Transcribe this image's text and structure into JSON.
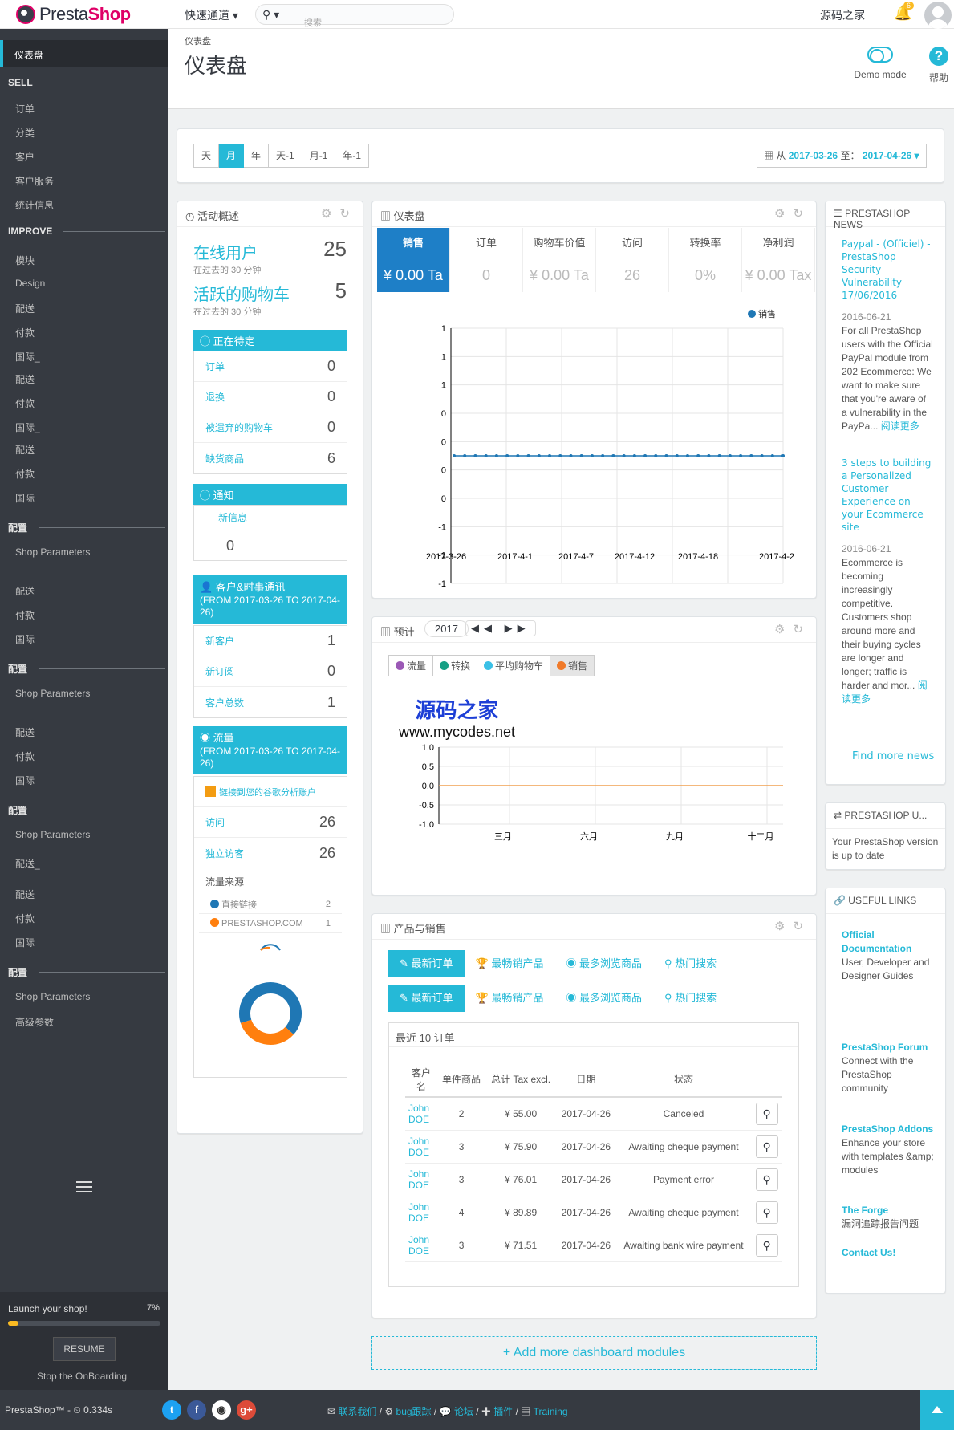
{
  "brand": {
    "name_part1": "Presta",
    "name_part2": "Shop"
  },
  "topbar": {
    "quick_access": "快速通道 ▾",
    "search_placeholder": "搜索",
    "shop_name": "源码之家",
    "notification_count": "6"
  },
  "sidebar": {
    "active": "仪表盘",
    "sections": [
      {
        "title": "SELL",
        "items": [
          "订单",
          "分类",
          "客户",
          "客户服务",
          "统计信息"
        ]
      },
      {
        "title": "IMPROVE",
        "items": [
          "模块",
          "Design",
          "配送",
          "付款",
          "国际_",
          "配送",
          "付款",
          "国际_",
          "配送",
          "付款",
          "国际"
        ]
      },
      {
        "title": "配置",
        "items": [
          "Shop Parameters",
          "配送",
          "付款",
          "国际"
        ]
      },
      {
        "title": "配置",
        "items": [
          "Shop Parameters",
          "配送",
          "付款",
          "国际"
        ]
      },
      {
        "title": "配置",
        "items": [
          "Shop Parameters",
          "配送_",
          "配送",
          "付款",
          "国际"
        ]
      },
      {
        "title": "配置",
        "items": [
          "Shop Parameters",
          "高级参数"
        ]
      }
    ],
    "launch": {
      "label": "Launch your shop!",
      "percent_text": "7%",
      "progress": 0.07,
      "resume": "RESUME",
      "stop": "Stop the OnBoarding"
    }
  },
  "header": {
    "breadcrumb": "仪表盘",
    "title": "仪表盘",
    "demo_mode": "Demo mode",
    "help": "帮助"
  },
  "datebar": {
    "periods": [
      "天",
      "月",
      "年",
      "天-1",
      "月-1",
      "年-1"
    ],
    "active_period": "月",
    "range_prefix": "从",
    "range_from": "2017-03-26",
    "range_sep": "至：",
    "range_to": "2017-04-26 ▾"
  },
  "activity": {
    "title": "活动概述",
    "online_label": "在线用户",
    "online_value": "25",
    "online_sub": "在过去的 30 分钟",
    "carts_label": "活跃的购物车",
    "carts_value": "5",
    "carts_sub": "在过去的 30 分钟",
    "pending_title": "正在待定",
    "pending": [
      {
        "label": "订单",
        "value": "0"
      },
      {
        "label": "退换",
        "value": "0"
      },
      {
        "label": "被遗弃的购物车",
        "value": "0"
      },
      {
        "label": "缺货商品",
        "value": "6"
      }
    ],
    "notif_title": "通知",
    "notif_label": "新信息",
    "notif_value": "0",
    "customers_title": "客户&时事通讯",
    "customers_range": "(FROM 2017-03-26 TO 2017-04-26)",
    "customers": [
      {
        "label": "新客户",
        "value": "1"
      },
      {
        "label": "新订阅",
        "value": "0"
      },
      {
        "label": "客户总数",
        "value": "1"
      }
    ],
    "traffic_title": "流量",
    "traffic_range": "(FROM 2017-03-26 TO 2017-04-26)",
    "ga_link": "链接到您的谷歌分析账户",
    "traffic": [
      {
        "label": "访问",
        "value": "26"
      },
      {
        "label": "独立访客",
        "value": "26"
      }
    ],
    "sources_title": "流量来源",
    "sources": [
      {
        "label": "直接链接",
        "value": "2",
        "color": "#1f77b4"
      },
      {
        "label": "PRESTASHOP.COM",
        "value": "1",
        "color": "#ff7f0e"
      }
    ]
  },
  "dashboard": {
    "title": "仪表盘",
    "kpis": [
      {
        "label": "销售",
        "value": "¥ 0.00 Ta"
      },
      {
        "label": "订单",
        "value": "0"
      },
      {
        "label": "购物车价值",
        "value": "¥ 0.00 Ta"
      },
      {
        "label": "访问",
        "value": "26"
      },
      {
        "label": "转换率",
        "value": "0%"
      },
      {
        "label": "净利润",
        "value": "¥ 0.00 Tax"
      }
    ]
  },
  "forecast": {
    "title": "预计",
    "year": "2017",
    "nav": "◀◀ ▶▶",
    "tabs": [
      {
        "label": "流量",
        "color": "#9b59b6"
      },
      {
        "label": "转换",
        "color": "#16a085"
      },
      {
        "label": "平均购物车",
        "color": "#3bc0e6"
      },
      {
        "label": "销售",
        "color": "#f07a2a"
      }
    ],
    "watermark_cn": "源码之家",
    "watermark_url": "www.mycodes.net"
  },
  "products": {
    "title": "产品与销售",
    "tabs": [
      "最新订单",
      "最畅销产品",
      "最多浏览商品",
      "热门搜索"
    ],
    "orders_caption": "最近 10 订单",
    "columns": [
      "客户名",
      "单件商品",
      "总计 Tax excl.",
      "日期",
      "状态"
    ],
    "rows": [
      {
        "customer": "John DOE",
        "qty": "2",
        "total": "¥ 55.00",
        "date": "2017-04-26",
        "status": "Canceled"
      },
      {
        "customer": "John DOE",
        "qty": "3",
        "total": "¥ 75.90",
        "date": "2017-04-26",
        "status": "Awaiting cheque payment"
      },
      {
        "customer": "John DOE",
        "qty": "3",
        "total": "¥ 76.01",
        "date": "2017-04-26",
        "status": "Payment error"
      },
      {
        "customer": "John DOE",
        "qty": "4",
        "total": "¥ 89.89",
        "date": "2017-04-26",
        "status": "Awaiting cheque payment"
      },
      {
        "customer": "John DOE",
        "qty": "3",
        "total": "¥ 71.51",
        "date": "2017-04-26",
        "status": "Awaiting bank wire payment"
      }
    ]
  },
  "add_modules": "+ Add more dashboard modules",
  "news": {
    "title": "PRESTASHOP NEWS",
    "items": [
      {
        "headline": "Paypal - (Officiel) - PrestaShop Security Vulnerability 17/06/2016",
        "date": "2016-06-21",
        "body": "For all PrestaShop users with the Official PayPal module from 202 Ecommerce: We want to make sure that you're aware of a vulnerability in the PayPa...",
        "more": "阅读更多"
      },
      {
        "headline": "3 steps to building a Personalized Customer Experience on your Ecommerce site",
        "date": "2016-06-21",
        "body": "Ecommerce is becoming increasingly competitive. Customers shop around more and their buying cycles are longer and longer; traffic is harder and mor...",
        "more": "阅读更多"
      }
    ],
    "find_more": "Find more news"
  },
  "update": {
    "title": "PRESTASHOP U...",
    "body": "Your PrestaShop version is up to date"
  },
  "links": {
    "title": "USEFUL LINKS",
    "items": [
      {
        "title": "Official Documentation",
        "sub": "User, Developer and Designer Guides"
      },
      {
        "title": "PrestaShop Forum",
        "sub": "Connect with the PrestaShop community"
      },
      {
        "title": "PrestaShop Addons",
        "sub": "Enhance your store with templates &amp; modules"
      },
      {
        "title": "The Forge",
        "sub": "漏洞追踪报告问题"
      },
      {
        "title": "Contact Us!",
        "sub": ""
      }
    ]
  },
  "footer": {
    "version": "PrestaShop™ - ⏲ 0.334s",
    "links": [
      "联系我们",
      "bug跟踪",
      "论坛",
      "插件",
      "Training"
    ]
  },
  "chart_data": [
    {
      "type": "line",
      "legend": [
        "销售"
      ],
      "x_ticks": [
        "2017-3-26",
        "2017-4-1",
        "2017-4-7",
        "2017-4-12",
        "2017-4-18",
        "2017-4-2"
      ],
      "y_ticks": [
        "1",
        "1",
        "1",
        "0",
        "0",
        "0",
        "0",
        "-1",
        "-1",
        "-1"
      ],
      "series": [
        {
          "name": "销售",
          "values": [
            0,
            0,
            0,
            0,
            0,
            0,
            0,
            0,
            0,
            0,
            0,
            0,
            0,
            0,
            0,
            0,
            0,
            0,
            0,
            0,
            0,
            0,
            0,
            0,
            0,
            0,
            0,
            0,
            0,
            0,
            0,
            0
          ]
        }
      ],
      "color": "#1f77b4"
    },
    {
      "type": "line",
      "x_ticks": [
        "三月",
        "六月",
        "九月",
        "十二月"
      ],
      "y_ticks": [
        "1.0",
        "0.5",
        "0.0",
        "-0.5",
        "-1.0"
      ],
      "ylim": [
        -1,
        1
      ],
      "series": [
        {
          "name": "销售",
          "values": [
            0,
            0,
            0,
            0,
            0,
            0,
            0,
            0,
            0,
            0,
            0,
            0
          ]
        }
      ],
      "color": "#f0a050"
    },
    {
      "type": "pie",
      "labels": [
        "直接链接",
        "PRESTASHOP.COM"
      ],
      "values": [
        2,
        1
      ],
      "colors": [
        "#1f77b4",
        "#ff7f0e"
      ]
    }
  ]
}
